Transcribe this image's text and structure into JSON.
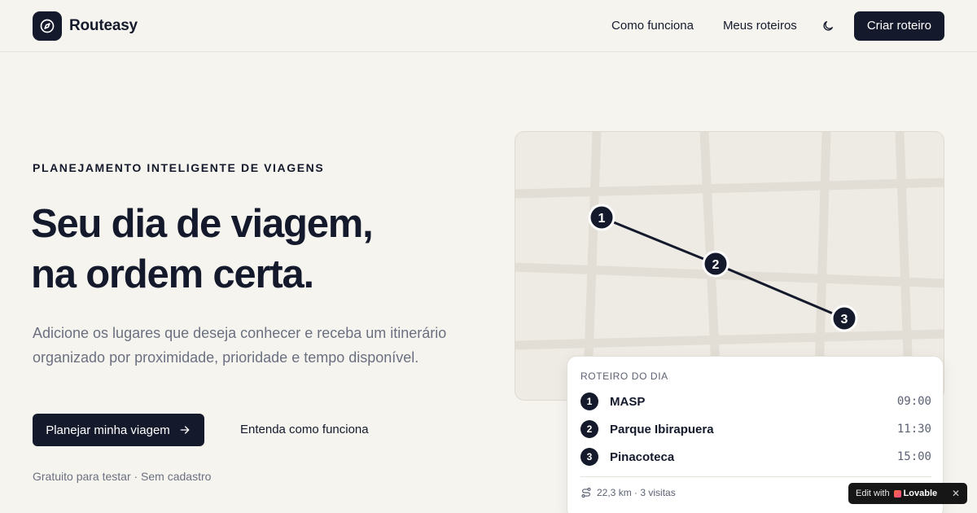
{
  "nav": {
    "brand": "Routeasy",
    "links": [
      "Como funciona",
      "Meus roteiros"
    ],
    "cta_label": "Criar roteiro",
    "logo_icon": "compass-icon",
    "theme_icon": "moon-icon"
  },
  "hero": {
    "eyebrow": "PLANEJAMENTO INTELIGENTE DE VIAGENS",
    "title_line1": "Seu dia de viagem,",
    "title_line2": "na ordem certa.",
    "subtitle": "Adicione os lugares que deseja conhecer e receba um itinerário organizado por proximidade, prioridade e tempo disponível.",
    "primary_cta": "Planejar minha viagem",
    "secondary_cta": "Entenda como funciona",
    "fineprint": "Gratuito para testar · Sem cadastro"
  },
  "map": {
    "markers": [
      "1",
      "2",
      "3"
    ]
  },
  "itinerary": {
    "title": "ROTEIRO DO DIA",
    "stops": [
      {
        "number": "1",
        "name": "MASP",
        "time": "09:00"
      },
      {
        "number": "2",
        "name": "Parque Ibirapuera",
        "time": "11:30"
      },
      {
        "number": "3",
        "name": "Pinacoteca",
        "time": "15:00"
      }
    ],
    "summary": "22,3 km · 3 visitas",
    "summary_icon": "route-icon"
  },
  "badge": {
    "prefix": "Edit with",
    "brand": "Lovable",
    "close": "✕"
  },
  "colors": {
    "background": "#f6f4ef",
    "primary": "#141a2c",
    "muted_text": "#6a7080",
    "map_background": "#eeebe4",
    "map_streets": "#e2ded6"
  }
}
